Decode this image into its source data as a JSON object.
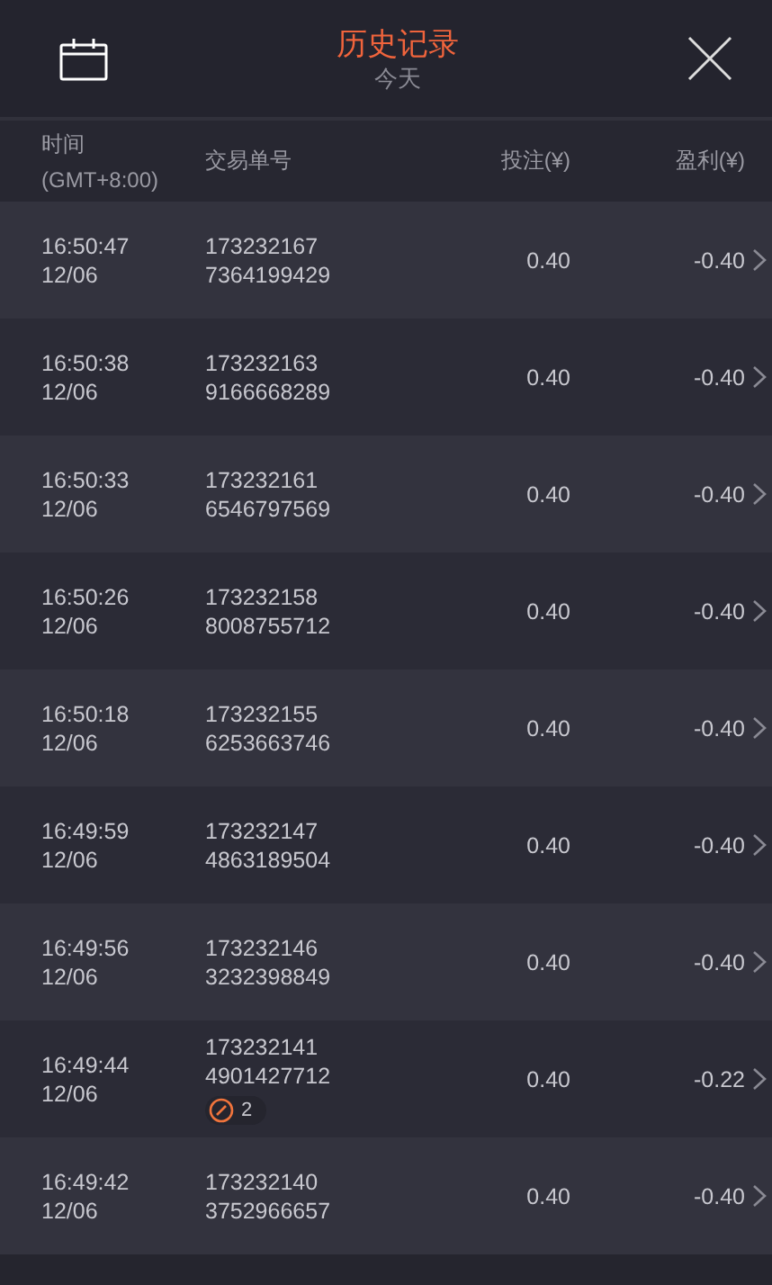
{
  "header": {
    "title": "历史记录",
    "subtitle": "今天"
  },
  "columns": {
    "time": "时间",
    "timezone": "(GMT+8:00)",
    "order": "交易单号",
    "bet": "投注(¥)",
    "profit": "盈利(¥)"
  },
  "rows": [
    {
      "time": "16:50:47",
      "date": "12/06",
      "order_1": "173232167",
      "order_2": "7364199429",
      "bet": "0.40",
      "profit": "-0.40"
    },
    {
      "time": "16:50:38",
      "date": "12/06",
      "order_1": "173232163",
      "order_2": "9166668289",
      "bet": "0.40",
      "profit": "-0.40"
    },
    {
      "time": "16:50:33",
      "date": "12/06",
      "order_1": "173232161",
      "order_2": "6546797569",
      "bet": "0.40",
      "profit": "-0.40"
    },
    {
      "time": "16:50:26",
      "date": "12/06",
      "order_1": "173232158",
      "order_2": "8008755712",
      "bet": "0.40",
      "profit": "-0.40"
    },
    {
      "time": "16:50:18",
      "date": "12/06",
      "order_1": "173232155",
      "order_2": "6253663746",
      "bet": "0.40",
      "profit": "-0.40"
    },
    {
      "time": "16:49:59",
      "date": "12/06",
      "order_1": "173232147",
      "order_2": "4863189504",
      "bet": "0.40",
      "profit": "-0.40"
    },
    {
      "time": "16:49:56",
      "date": "12/06",
      "order_1": "173232146",
      "order_2": "3232398849",
      "bet": "0.40",
      "profit": "-0.40"
    },
    {
      "time": "16:49:44",
      "date": "12/06",
      "order_1": "173232141",
      "order_2": "4901427712",
      "badge": "2",
      "bet": "0.40",
      "profit": "-0.22"
    },
    {
      "time": "16:49:42",
      "date": "12/06",
      "order_1": "173232140",
      "order_2": "3752966657",
      "bet": "0.40",
      "profit": "-0.40"
    }
  ]
}
